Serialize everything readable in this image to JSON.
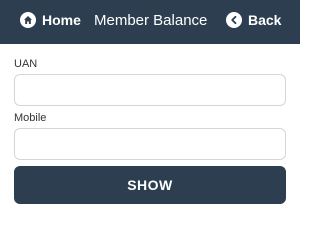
{
  "header": {
    "title": "Member Balance",
    "home_label": "Home",
    "back_label": "Back",
    "background_color": "#2c3e50",
    "home_icon": "home-icon",
    "back_icon": "chevron-left-icon"
  },
  "form": {
    "uan_label": "UAN",
    "uan_value": "",
    "uan_placeholder": "",
    "mobile_label": "Mobile",
    "mobile_value": "",
    "mobile_placeholder": "",
    "submit_label": "SHOW",
    "button_color": "#2c3e50"
  }
}
